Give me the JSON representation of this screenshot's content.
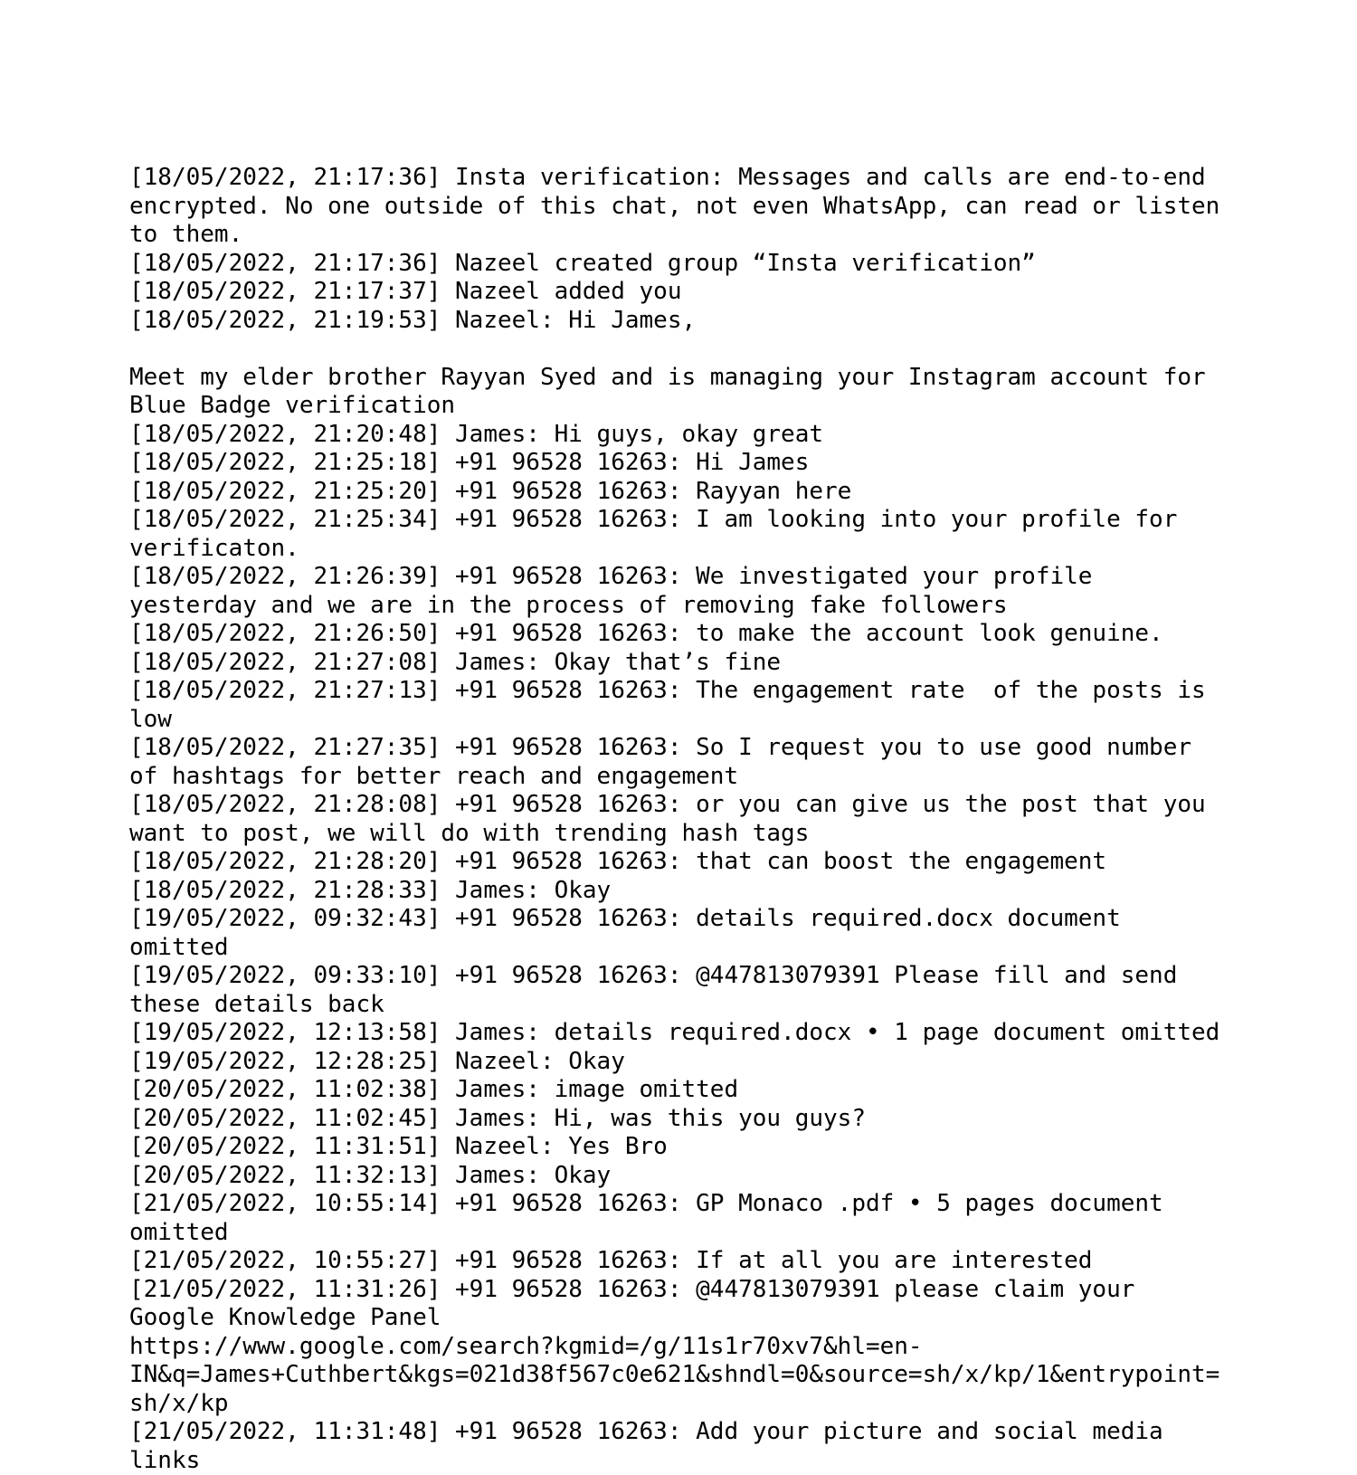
{
  "document": {
    "type": "whatsapp-chat-transcript-export",
    "chat_name": "Insta verification",
    "lines": [
      "[18/05/2022, 21:17:36] Insta verification: Messages and calls are end-to-end encrypted. No one outside of this chat, not even WhatsApp, can read or listen to them.",
      "[18/05/2022, 21:17:36] Nazeel created group “Insta verification”",
      "[18/05/2022, 21:17:37] Nazeel added you",
      "[18/05/2022, 21:19:53] Nazeel: Hi James,",
      "",
      "Meet my elder brother Rayyan Syed and is managing your Instagram account for Blue Badge verification",
      "[18/05/2022, 21:20:48] James: Hi guys, okay great",
      "[18/05/2022, 21:25:18] +91 96528 16263: Hi James",
      "[18/05/2022, 21:25:20] +91 96528 16263: Rayyan here",
      "[18/05/2022, 21:25:34] +91 96528 16263: I am looking into your profile for verificaton.",
      "[18/05/2022, 21:26:39] +91 96528 16263: We investigated your profile yesterday and we are in the process of removing fake followers",
      "[18/05/2022, 21:26:50] +91 96528 16263: to make the account look genuine.",
      "[18/05/2022, 21:27:08] James: Okay that’s fine",
      "[18/05/2022, 21:27:13] +91 96528 16263: The engagement rate  of the posts is low",
      "[18/05/2022, 21:27:35] +91 96528 16263: So I request you to use good number of hashtags for better reach and engagement",
      "[18/05/2022, 21:28:08] +91 96528 16263: or you can give us the post that you want to post, we will do with trending hash tags",
      "[18/05/2022, 21:28:20] +91 96528 16263: that can boost the engagement",
      "[18/05/2022, 21:28:33] James: Okay",
      "[19/05/2022, 09:32:43] +91 96528 16263: details required.docx document omitted",
      "[19/05/2022, 09:33:10] +91 96528 16263: @447813079391 Please fill and send these details back",
      "[19/05/2022, 12:13:58] James: details required.docx • 1 page document omitted",
      "[19/05/2022, 12:28:25] Nazeel: Okay",
      "[20/05/2022, 11:02:38] James: image omitted",
      "[20/05/2022, 11:02:45] James: Hi, was this you guys?",
      "[20/05/2022, 11:31:51] Nazeel: Yes Bro",
      "[20/05/2022, 11:32:13] James: Okay",
      "[21/05/2022, 10:55:14] +91 96528 16263: GP Monaco .pdf • 5 pages document omitted",
      "[21/05/2022, 10:55:27] +91 96528 16263: If at all you are interested",
      "[21/05/2022, 11:31:26] +91 96528 16263: @447813079391 please claim your Google Knowledge Panel",
      "https://www.google.com/search?kgmid=/g/11s1r70xv7&hl=en-IN&q=James+Cuthbert&kgs=021d38f567c0e621&shndl=0&source=sh/x/kp/1&entrypoint=sh/x/kp",
      "[21/05/2022, 11:31:48] +91 96528 16263: Add your picture and social media links"
    ]
  },
  "colors": {
    "page_background": "#ffffff",
    "text": "#000000"
  }
}
